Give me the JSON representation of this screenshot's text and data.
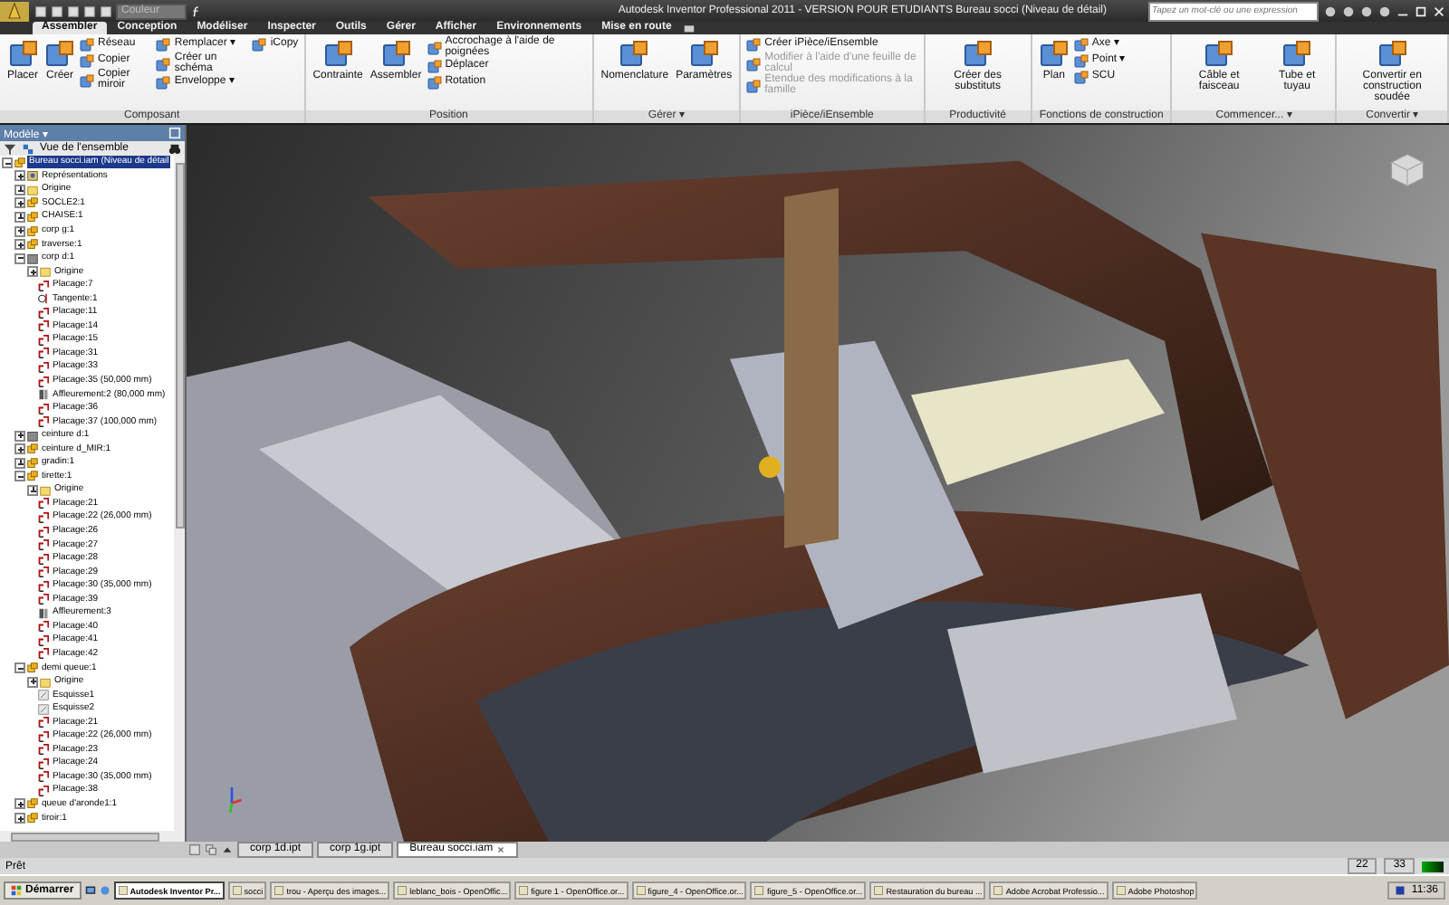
{
  "window": {
    "title": "Autodesk Inventor Professional 2011 - VERSION POUR ETUDIANTS   Bureau socci (Niveau de détail)",
    "quick_access": {
      "style_field": "Couleur"
    },
    "search": {
      "placeholder": "Tapez un mot-clé ou une expression"
    }
  },
  "tabs": [
    {
      "label": "Assembler",
      "selected": true
    },
    {
      "label": "Conception",
      "selected": false
    },
    {
      "label": "Modéliser",
      "selected": false
    },
    {
      "label": "Inspecter",
      "selected": false
    },
    {
      "label": "Outils",
      "selected": false
    },
    {
      "label": "Gérer",
      "selected": false
    },
    {
      "label": "Afficher",
      "selected": false
    },
    {
      "label": "Environnements",
      "selected": false
    },
    {
      "label": "Mise en route",
      "selected": false
    }
  ],
  "ribbon": [
    {
      "title": "Composant",
      "groups": [
        {
          "kind": "large",
          "tools": [
            {
              "label": "Placer",
              "disabled": false
            },
            {
              "label": "Créer",
              "disabled": false
            }
          ]
        },
        {
          "kind": "stack",
          "tools": [
            {
              "label": "Réseau",
              "disabled": false
            },
            {
              "label": "Copier",
              "disabled": false
            },
            {
              "label": "Copier miroir",
              "disabled": false
            }
          ]
        },
        {
          "kind": "stack",
          "tools": [
            {
              "label": "Remplacer ▾",
              "disabled": false
            },
            {
              "label": "Créer un schéma",
              "disabled": false
            },
            {
              "label": "Enveloppe ▾",
              "disabled": false
            }
          ]
        },
        {
          "kind": "stack",
          "tools": [
            {
              "label": "iCopy",
              "disabled": false
            }
          ]
        }
      ]
    },
    {
      "title": "Position",
      "groups": [
        {
          "kind": "large",
          "tools": [
            {
              "label": "Contrainte",
              "disabled": false
            },
            {
              "label": "Assembler",
              "disabled": false
            }
          ]
        },
        {
          "kind": "stack",
          "tools": [
            {
              "label": "Accrochage à l'aide de poignées",
              "disabled": false
            },
            {
              "label": "Déplacer",
              "disabled": false
            },
            {
              "label": "Rotation",
              "disabled": false
            }
          ]
        }
      ]
    },
    {
      "title": "Gérer ▾",
      "groups": [
        {
          "kind": "large",
          "tools": [
            {
              "label": "Nomenclature",
              "disabled": false
            },
            {
              "label": "Paramètres",
              "disabled": false
            }
          ]
        }
      ]
    },
    {
      "title": "iPièce/iEnsemble",
      "groups": [
        {
          "kind": "stack",
          "tools": [
            {
              "label": "Créer iPièce/iEnsemble",
              "disabled": false
            },
            {
              "label": "Modifier à l'aide d'une feuille de calcul",
              "disabled": true
            },
            {
              "label": "Etendue des modifications à la famille",
              "disabled": true
            }
          ]
        }
      ]
    },
    {
      "title": "Productivité",
      "groups": [
        {
          "kind": "large",
          "tools": [
            {
              "label": "Créer des substituts",
              "disabled": false
            }
          ]
        }
      ]
    },
    {
      "title": "Fonctions de construction",
      "groups": [
        {
          "kind": "large",
          "tools": [
            {
              "label": "Plan",
              "disabled": false
            }
          ]
        },
        {
          "kind": "stack",
          "tools": [
            {
              "label": "Axe ▾",
              "disabled": false
            },
            {
              "label": "Point ▾",
              "disabled": false
            },
            {
              "label": "SCU",
              "disabled": false
            }
          ]
        }
      ]
    },
    {
      "title": "Commencer... ▾",
      "groups": [
        {
          "kind": "large",
          "tools": [
            {
              "label": "Câble et faisceau",
              "disabled": false
            },
            {
              "label": "Tube et tuyau",
              "disabled": false
            }
          ]
        }
      ]
    },
    {
      "title": "Convertir ▾",
      "groups": [
        {
          "kind": "large",
          "tools": [
            {
              "label": "Convertir en construction soudée",
              "disabled": false
            }
          ]
        }
      ]
    }
  ],
  "browser": {
    "title": "Modèle ▾",
    "view": "Vue de l'ensemble",
    "tree": [
      {
        "label": "Bureau socci.iam (Niveau de détail",
        "kind": "assembly",
        "selected": true,
        "expanded": true,
        "children": [
          {
            "label": "Représentations",
            "kind": "representation",
            "selected": false,
            "expanded": false
          },
          {
            "label": "Origine",
            "kind": "folder",
            "selected": false,
            "expanded": false
          },
          {
            "label": "SOCLE2:1",
            "kind": "component",
            "selected": false,
            "expanded": false
          },
          {
            "label": "CHAISE:1",
            "kind": "component",
            "selected": false,
            "expanded": false
          },
          {
            "label": "corp g:1",
            "kind": "component",
            "selected": false,
            "expanded": false
          },
          {
            "label": "traverse:1",
            "kind": "component",
            "selected": false,
            "expanded": false
          },
          {
            "label": "corp d:1",
            "kind": "part",
            "selected": false,
            "expanded": true,
            "children": [
              {
                "label": "Origine",
                "kind": "folder",
                "selected": false,
                "expanded": false
              },
              {
                "label": "Placage:7",
                "kind": "constraint",
                "selected": false
              },
              {
                "label": "Tangente:1",
                "kind": "tangent",
                "selected": false
              },
              {
                "label": "Placage:11",
                "kind": "constraint",
                "selected": false
              },
              {
                "label": "Placage:14",
                "kind": "constraint",
                "selected": false
              },
              {
                "label": "Placage:15",
                "kind": "constraint",
                "selected": false
              },
              {
                "label": "Placage:31",
                "kind": "constraint",
                "selected": false
              },
              {
                "label": "Placage:33",
                "kind": "constraint",
                "selected": false
              },
              {
                "label": "Placage:35 (50,000 mm)",
                "kind": "constraint",
                "selected": false
              },
              {
                "label": "Affleurement:2 (80,000 mm)",
                "kind": "flush",
                "selected": false
              },
              {
                "label": "Placage:36",
                "kind": "constraint",
                "selected": false
              },
              {
                "label": "Placage:37 (100,000 mm)",
                "kind": "constraint",
                "selected": false
              }
            ]
          },
          {
            "label": "ceinture d:1",
            "kind": "part",
            "selected": false,
            "expanded": false
          },
          {
            "label": "ceinture d_MIR:1",
            "kind": "component",
            "selected": false,
            "expanded": false
          },
          {
            "label": "gradin:1",
            "kind": "component",
            "selected": false,
            "expanded": false
          },
          {
            "label": "tirette:1",
            "kind": "component",
            "selected": false,
            "expanded": true,
            "children": [
              {
                "label": "Origine",
                "kind": "folder",
                "selected": false,
                "expanded": false
              },
              {
                "label": "Placage:21",
                "kind": "constraint",
                "selected": false
              },
              {
                "label": "Placage:22 (26,000 mm)",
                "kind": "constraint",
                "selected": false
              },
              {
                "label": "Placage:26",
                "kind": "constraint",
                "selected": false
              },
              {
                "label": "Placage:27",
                "kind": "constraint",
                "selected": false
              },
              {
                "label": "Placage:28",
                "kind": "constraint",
                "selected": false
              },
              {
                "label": "Placage:29",
                "kind": "constraint",
                "selected": false
              },
              {
                "label": "Placage:30 (35,000 mm)",
                "kind": "constraint",
                "selected": false
              },
              {
                "label": "Placage:39",
                "kind": "constraint",
                "selected": false
              },
              {
                "label": "Affleurement:3",
                "kind": "flush",
                "selected": false
              },
              {
                "label": "Placage:40",
                "kind": "constraint",
                "selected": false
              },
              {
                "label": "Placage:41",
                "kind": "constraint",
                "selected": false
              },
              {
                "label": "Placage:42",
                "kind": "constraint",
                "selected": false
              }
            ]
          },
          {
            "label": "demi queue:1",
            "kind": "component",
            "selected": false,
            "expanded": true,
            "children": [
              {
                "label": "Origine",
                "kind": "folder",
                "selected": false,
                "expanded": false
              },
              {
                "label": "Esquisse1",
                "kind": "sketch",
                "selected": false
              },
              {
                "label": "Esquisse2",
                "kind": "sketch",
                "selected": false
              },
              {
                "label": "Placage:21",
                "kind": "constraint",
                "selected": false
              },
              {
                "label": "Placage:22 (26,000 mm)",
                "kind": "constraint",
                "selected": false
              },
              {
                "label": "Placage:23",
                "kind": "constraint",
                "selected": false
              },
              {
                "label": "Placage:24",
                "kind": "constraint",
                "selected": false
              },
              {
                "label": "Placage:30 (35,000 mm)",
                "kind": "constraint",
                "selected": false
              },
              {
                "label": "Placage:38",
                "kind": "constraint",
                "selected": false
              }
            ]
          },
          {
            "label": "queue d'aronde1:1",
            "kind": "component",
            "selected": false,
            "expanded": false
          },
          {
            "label": "tiroir:1",
            "kind": "component",
            "selected": false,
            "expanded": false
          }
        ]
      }
    ]
  },
  "document_tabs": [
    {
      "label": "corp 1d.ipt",
      "selected": false
    },
    {
      "label": "corp 1g.ipt",
      "selected": false
    },
    {
      "label": "Bureau socci.iam",
      "selected": true
    }
  ],
  "status_bar": {
    "message": "Prêt",
    "value_1": "22",
    "value_2": "33"
  },
  "taskbar": {
    "start": "Démarrer",
    "items": [
      {
        "label": "Autodesk Inventor Pr...",
        "selected": true
      },
      {
        "label": "socci",
        "selected": false
      },
      {
        "label": "trou - Aperçu des images...",
        "selected": false
      },
      {
        "label": "leblanc_bois - OpenOffic...",
        "selected": false
      },
      {
        "label": "figure 1 - OpenOffice.or...",
        "selected": false
      },
      {
        "label": "figure_4 - OpenOffice.or...",
        "selected": false
      },
      {
        "label": "figure_5 - OpenOffice.or...",
        "selected": false
      },
      {
        "label": "Restauration du bureau ...",
        "selected": false
      },
      {
        "label": "Adobe Acrobat Professio...",
        "selected": false
      },
      {
        "label": "Adobe Photoshop",
        "selected": false
      }
    ],
    "clock": "11:36"
  }
}
